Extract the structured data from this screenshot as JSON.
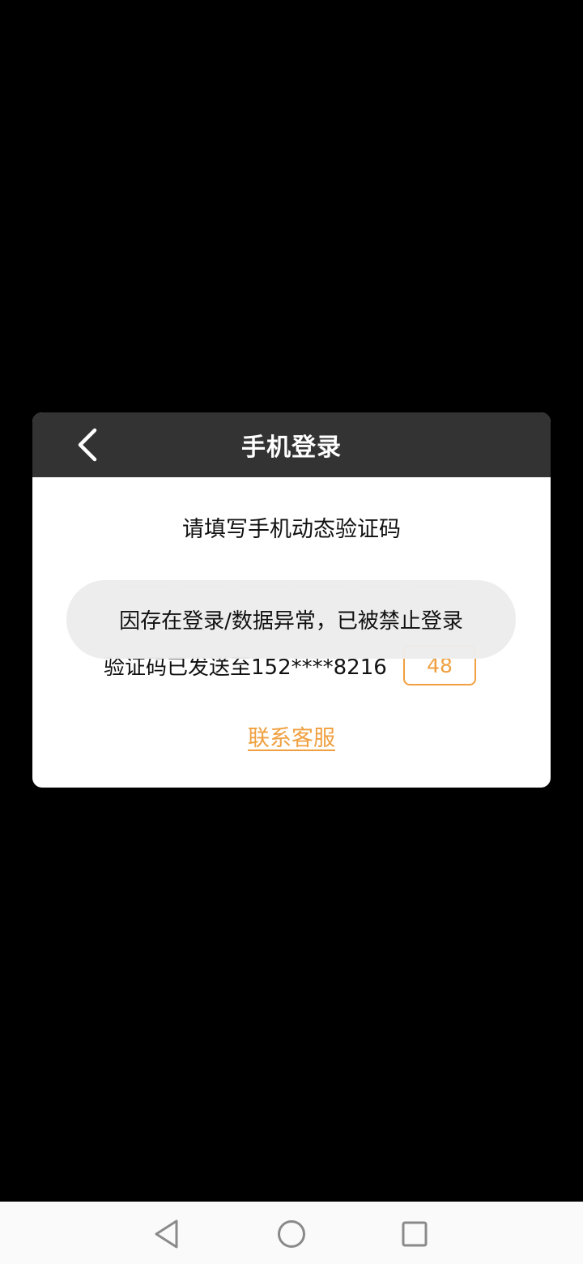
{
  "dialog": {
    "title": "手机登录",
    "back_icon": "chevron-left-icon",
    "subtitle": "请填写手机动态验证码",
    "code_slots": 6,
    "sent_text": "验证码已发送至152****8216",
    "countdown": "48",
    "contact_link": "联系客服"
  },
  "toast": {
    "message": "因存在登录/数据异常，已被禁止登录"
  },
  "nav": {
    "back_icon": "nav-back-icon",
    "home_icon": "nav-home-icon",
    "recents_icon": "nav-recents-icon"
  },
  "colors": {
    "accent": "#f0a040",
    "header_bg": "#333333",
    "background": "#000000"
  }
}
